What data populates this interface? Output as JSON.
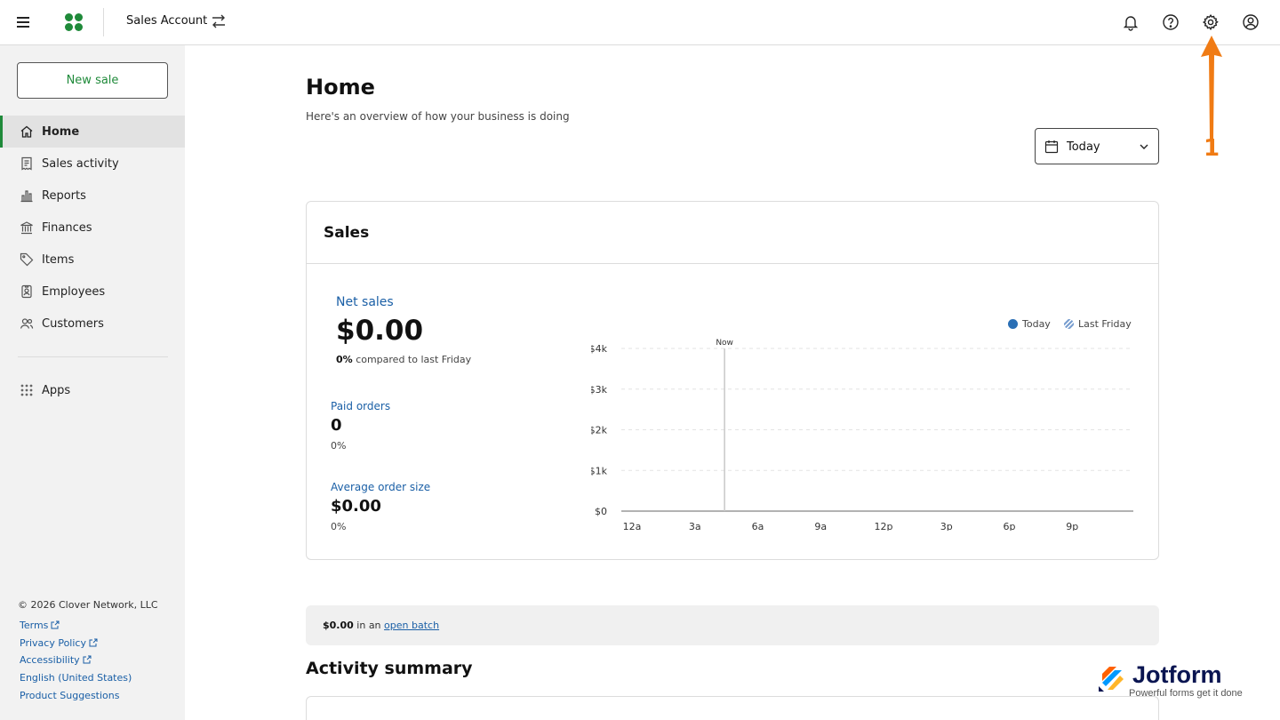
{
  "topbar": {
    "account_name": "Sales Account"
  },
  "sidebar": {
    "new_sale_label": "New sale",
    "items": [
      {
        "label": "Home",
        "icon": "home-icon"
      },
      {
        "label": "Sales activity",
        "icon": "receipt-icon"
      },
      {
        "label": "Reports",
        "icon": "bar-chart-icon"
      },
      {
        "label": "Finances",
        "icon": "bank-icon"
      },
      {
        "label": "Items",
        "icon": "tag-icon"
      },
      {
        "label": "Employees",
        "icon": "badge-icon"
      },
      {
        "label": "Customers",
        "icon": "people-icon"
      }
    ],
    "apps_label": "Apps",
    "copyright": "© 2026 Clover Network, LLC",
    "footer_links": [
      "Terms",
      "Privacy Policy",
      "Accessibility",
      "English (United States)",
      "Product Suggestions"
    ]
  },
  "main": {
    "title": "Home",
    "subtitle": "Here's an overview of how your business is doing",
    "date_range": "Today"
  },
  "sales_card": {
    "title": "Sales",
    "net_sales_label": "Net sales",
    "net_sales_value": "$0.00",
    "net_sales_pct": "0%",
    "net_sales_compare": "compared to last Friday",
    "paid_orders_label": "Paid orders",
    "paid_orders_value": "0",
    "paid_orders_pct": "0%",
    "avg_order_label": "Average order size",
    "avg_order_value": "$0.00",
    "avg_order_pct": "0%"
  },
  "chart_data": {
    "type": "line",
    "x": [
      "12a",
      "3a",
      "6a",
      "9a",
      "12p",
      "3p",
      "6p",
      "9p"
    ],
    "y_ticks": [
      "$0",
      "$1k",
      "$2k",
      "$3k",
      "$4k"
    ],
    "ylim": [
      0,
      4000
    ],
    "series": [
      {
        "name": "Today",
        "values": [],
        "color": "#2a6fb5"
      },
      {
        "name": "Last Friday",
        "values": [],
        "color": "#7a9fd0"
      }
    ],
    "now_label": "Now",
    "now_x": "4:30a",
    "legend_position": "top-right",
    "grid": true
  },
  "batch": {
    "amount": "$0.00",
    "in_text": "in an",
    "link_text": "open batch"
  },
  "activity_title": "Activity summary",
  "annotation": {
    "step_number": "1",
    "color": "#f07b14"
  },
  "watermark": {
    "brand": "Jotform",
    "tagline": "Powerful forms get it done"
  }
}
